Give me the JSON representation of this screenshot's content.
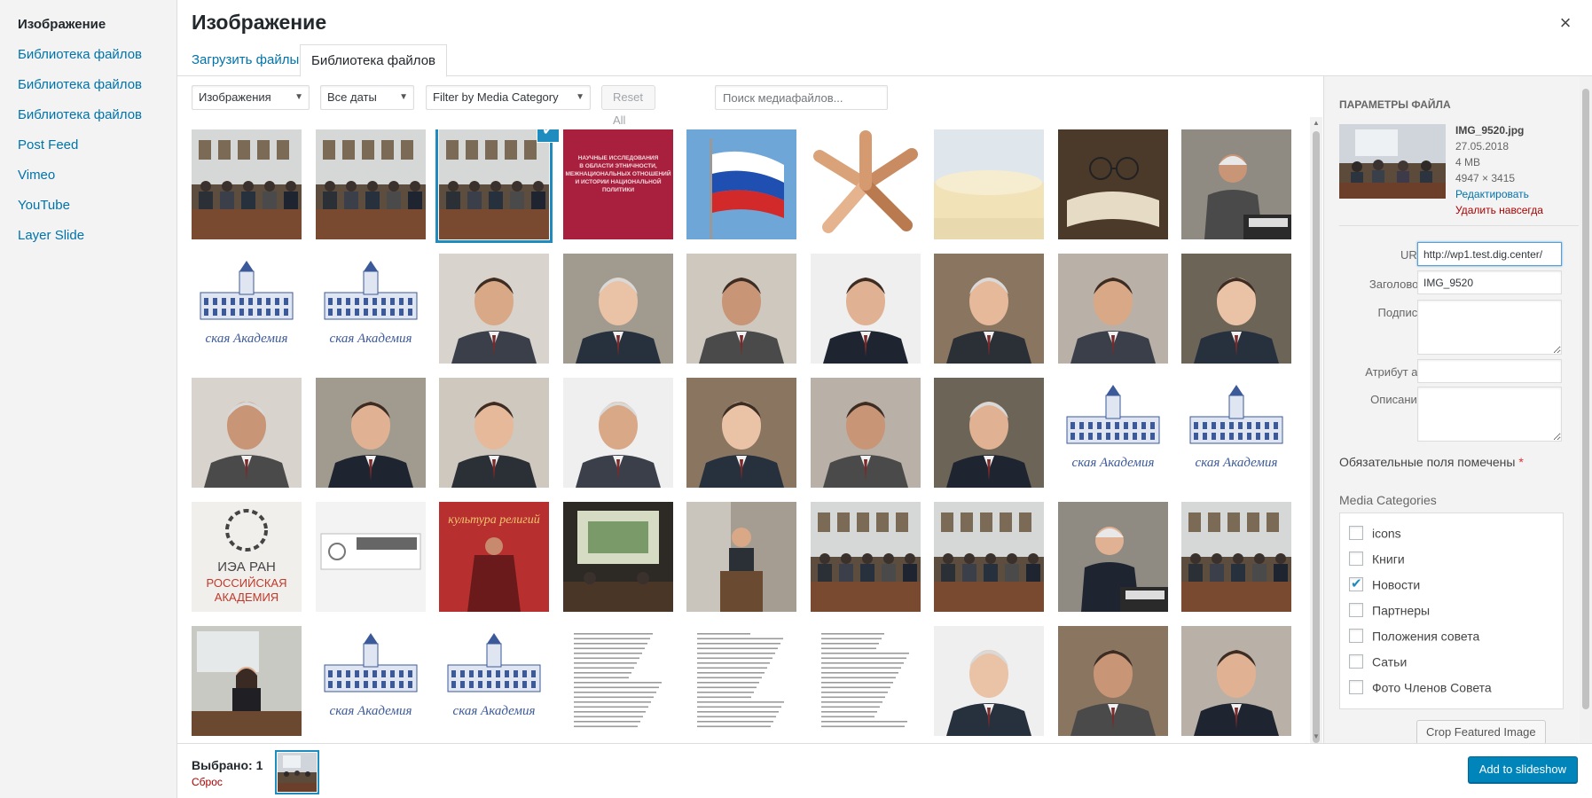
{
  "menu": {
    "items": [
      {
        "label": "Изображение",
        "active": true
      },
      {
        "label": "Библиотека файлов"
      },
      {
        "label": "Библиотека файлов"
      },
      {
        "label": "Библиотека файлов"
      },
      {
        "label": "Post Feed"
      },
      {
        "label": "Vimeo"
      },
      {
        "label": "YouTube"
      },
      {
        "label": "Layer Slide"
      }
    ]
  },
  "header": {
    "title": "Изображение",
    "close_icon": "×"
  },
  "tabs": [
    {
      "label": "Загрузить файлы"
    },
    {
      "label": "Библиотека файлов",
      "active": true
    }
  ],
  "toolbar": {
    "type_filter": "Изображения",
    "date_filter": "Все даты",
    "category_filter": "Filter by Media Category",
    "reset_label": "Reset All Filters",
    "search_placeholder": "Поиск медиафайлов..."
  },
  "grid": {
    "items": [
      {
        "kind": "meeting"
      },
      {
        "kind": "meeting"
      },
      {
        "kind": "meeting",
        "selected": true
      },
      {
        "kind": "book-red"
      },
      {
        "kind": "flag"
      },
      {
        "kind": "hands"
      },
      {
        "kind": "sky"
      },
      {
        "kind": "book-glasses"
      },
      {
        "kind": "portrait-speaker"
      },
      {
        "kind": "academy-logo"
      },
      {
        "kind": "academy-logo"
      },
      {
        "kind": "portrait"
      },
      {
        "kind": "portrait"
      },
      {
        "kind": "portrait"
      },
      {
        "kind": "portrait"
      },
      {
        "kind": "portrait"
      },
      {
        "kind": "portrait"
      },
      {
        "kind": "portrait"
      },
      {
        "kind": "portrait"
      },
      {
        "kind": "portrait"
      },
      {
        "kind": "portrait"
      },
      {
        "kind": "portrait"
      },
      {
        "kind": "portrait"
      },
      {
        "kind": "portrait"
      },
      {
        "kind": "portrait"
      },
      {
        "kind": "academy-logo"
      },
      {
        "kind": "academy-logo"
      },
      {
        "kind": "iea-logo"
      },
      {
        "kind": "banner-gray"
      },
      {
        "kind": "book-culture"
      },
      {
        "kind": "presentation"
      },
      {
        "kind": "speaker-podium"
      },
      {
        "kind": "meeting"
      },
      {
        "kind": "meeting"
      },
      {
        "kind": "portrait-speaker"
      },
      {
        "kind": "meeting"
      },
      {
        "kind": "speaker-woman"
      },
      {
        "kind": "academy-logo"
      },
      {
        "kind": "academy-logo"
      },
      {
        "kind": "document"
      },
      {
        "kind": "document"
      },
      {
        "kind": "document"
      },
      {
        "kind": "portrait"
      },
      {
        "kind": "portrait"
      },
      {
        "kind": "portrait"
      }
    ]
  },
  "iea_logo": {
    "line1": "ИЭА РАН",
    "line2": "РОССИЙСКАЯ",
    "line3": "АКАДЕМИЯ"
  },
  "book_red_text": "НАУЧНЫЕ ИССЛЕДОВАНИЯ В ОБЛАСТИ ЭТНИЧНОСТИ, МЕЖНАЦИОНАЛЬНЫХ ОТНОШЕНИЙ И ИСТОРИИ НАЦИОНАЛЬНОЙ ПОЛИТИКИ",
  "book_culture_text": "культура религий",
  "academy_script": "ская Академия",
  "sidebar": {
    "heading": "Параметры файла",
    "filename": "IMG_9520.jpg",
    "date": "27.05.2018",
    "size": "4 MB",
    "dimensions": "4947 × 3415",
    "edit_link": "Редактировать",
    "delete_link": "Удалить навсегда",
    "fields": {
      "url_label": "URL",
      "url_value": "http://wp1.test.dig.center/",
      "title_label": "Заголовок",
      "title_value": "IMG_9520",
      "caption_label": "Подпись",
      "alt_label": "Атрибут alt",
      "description_label": "Описание"
    },
    "required_note": "Обязательные поля помечены",
    "required_star": "*",
    "media_categories_label": "Media Categories",
    "categories": [
      {
        "label": "icons",
        "checked": false
      },
      {
        "label": "Книги",
        "checked": false
      },
      {
        "label": "Новости",
        "checked": true
      },
      {
        "label": "Партнеры",
        "checked": false
      },
      {
        "label": "Положения совета",
        "checked": false
      },
      {
        "label": "Сатьи",
        "checked": false
      },
      {
        "label": "Фото Членов Совета",
        "checked": false
      }
    ],
    "crop_button": "Crop Featured Image"
  },
  "footer": {
    "selected_label": "Выбрано: 1",
    "reset_link": "Сброс",
    "primary_button": "Add to slideshow"
  },
  "colors": {
    "accent": "#0073aa",
    "selection": "#1e8cbe",
    "primary": "#0085ba",
    "danger": "#a00"
  }
}
